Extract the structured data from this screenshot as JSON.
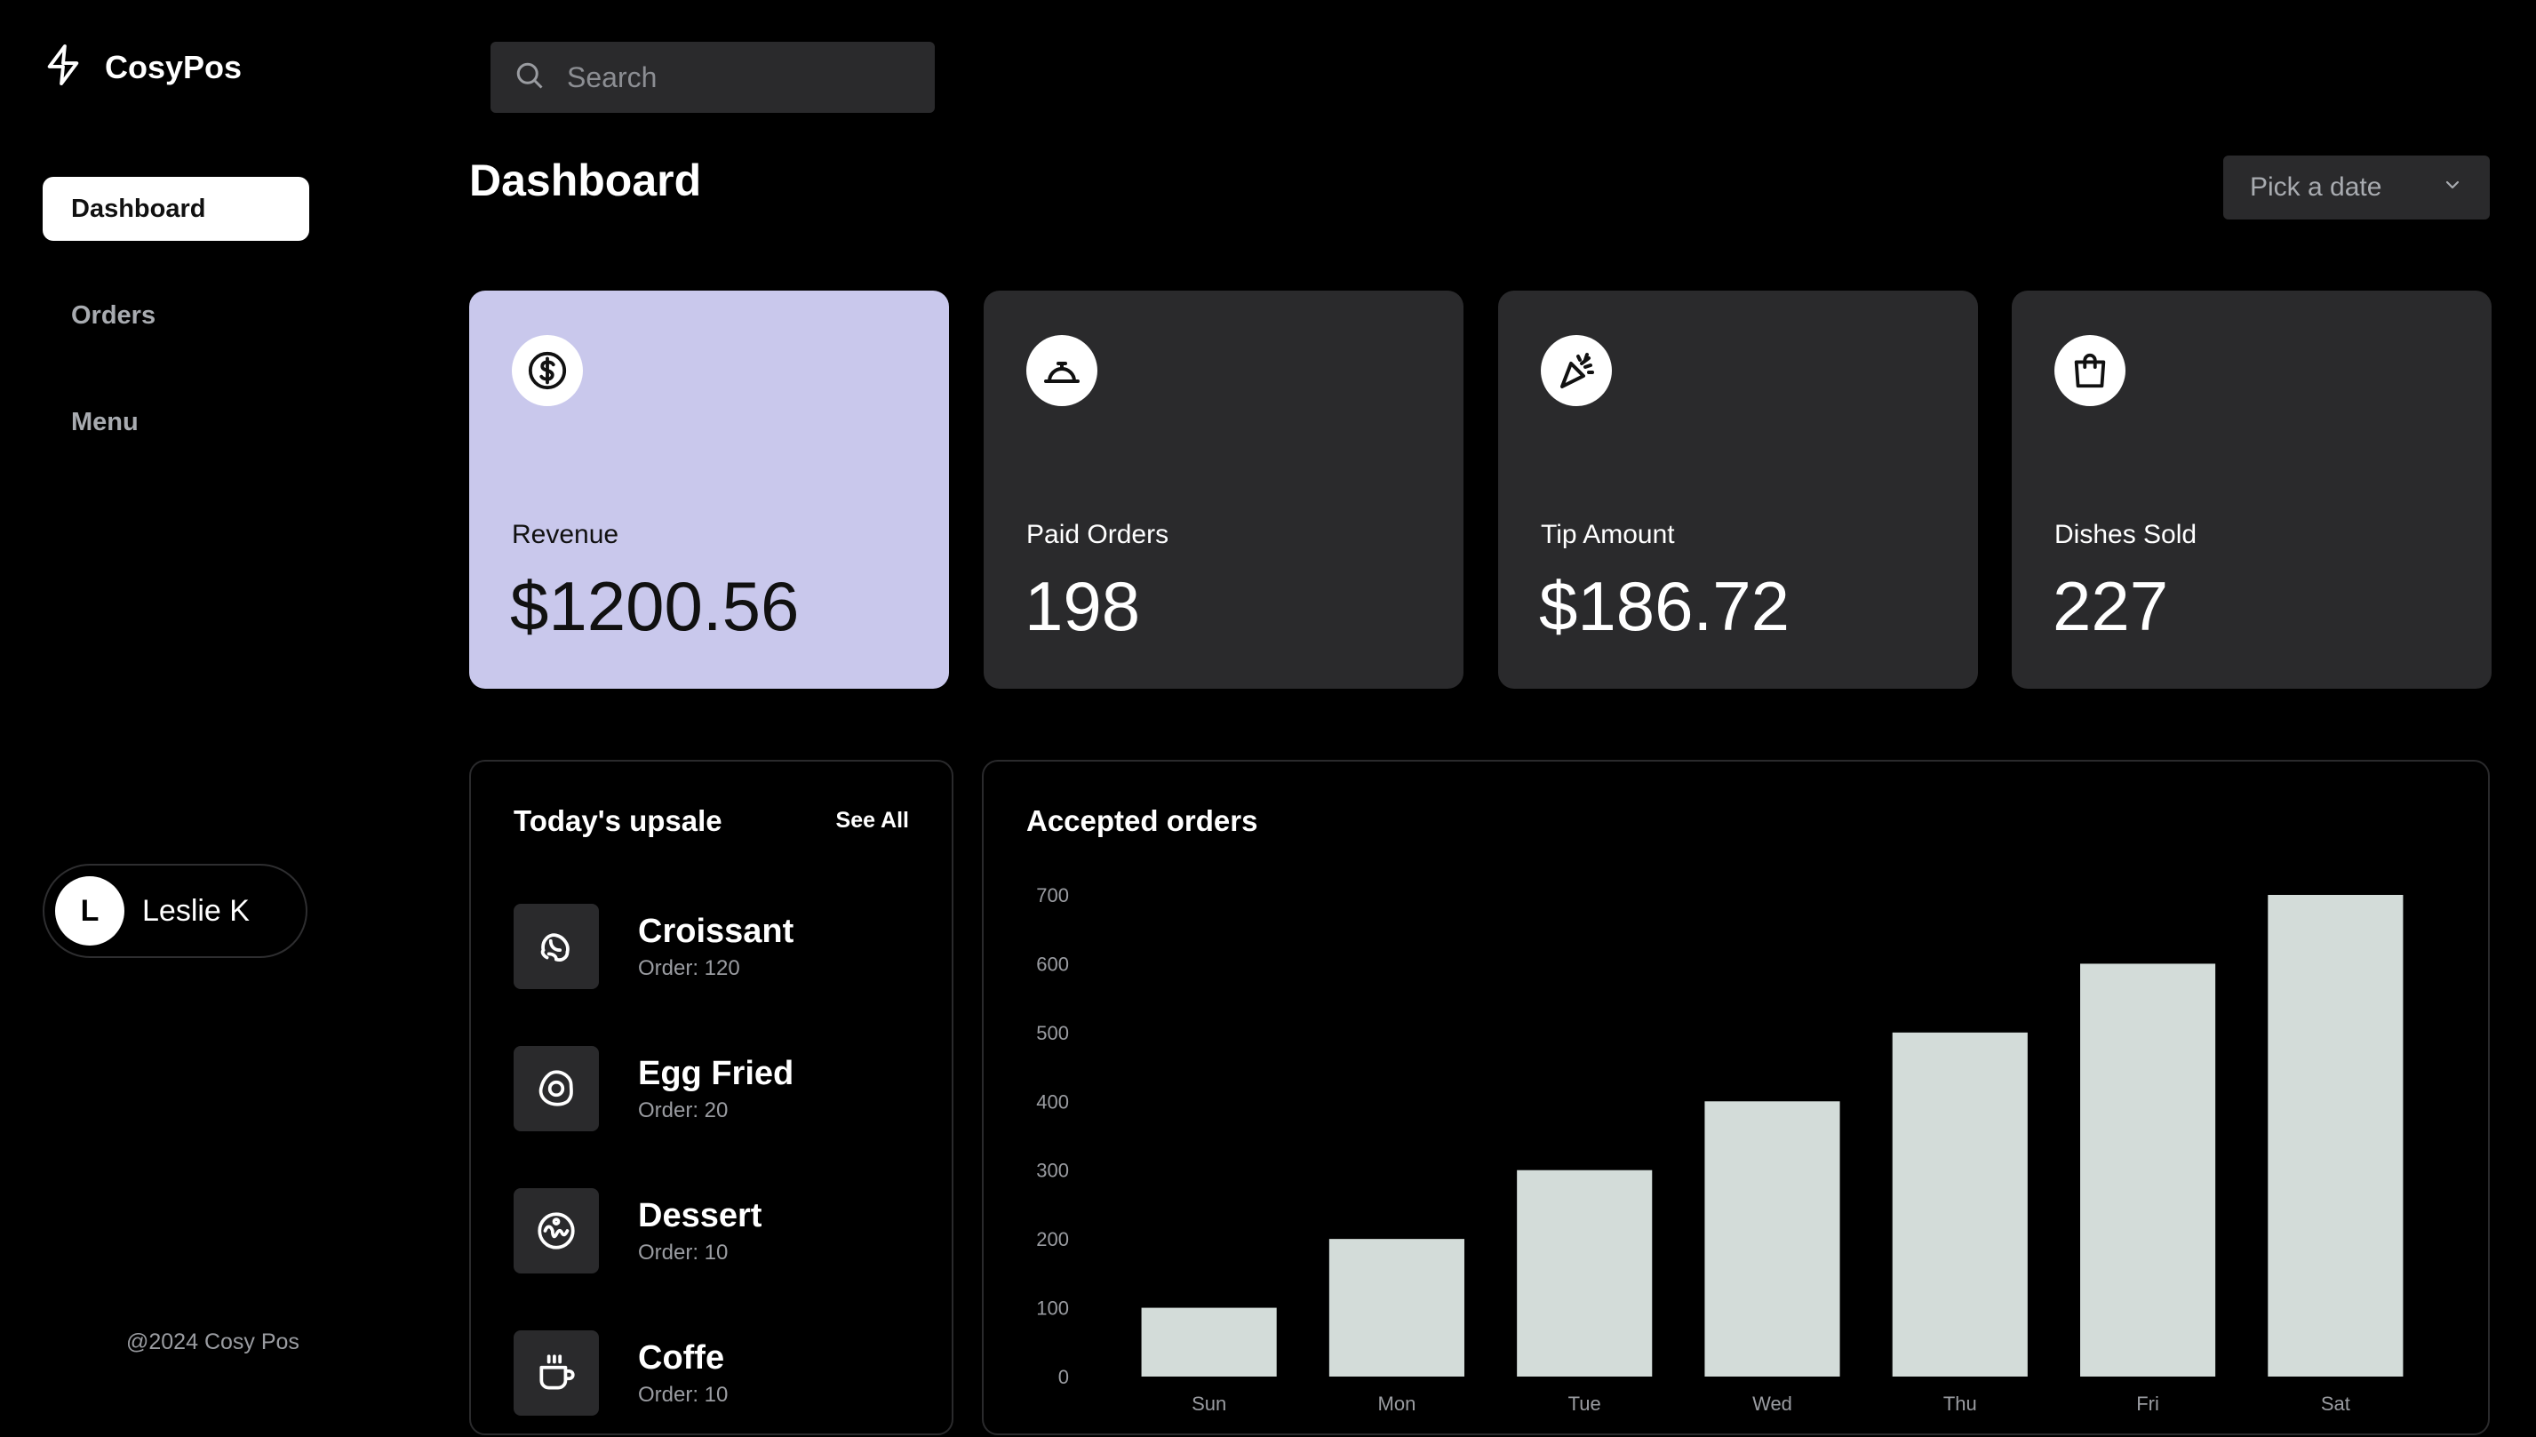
{
  "brand": {
    "name": "CosyPos",
    "icon": "bolt-icon"
  },
  "sidebar": {
    "items": [
      {
        "label": "Dashboard",
        "active": true
      },
      {
        "label": "Orders",
        "active": false
      },
      {
        "label": "Menu",
        "active": false
      }
    ],
    "user": {
      "initial": "L",
      "name": "Leslie K"
    },
    "footer": "@2024 Cosy Pos"
  },
  "search": {
    "placeholder": "Search"
  },
  "page": {
    "title": "Dashboard",
    "date_picker": "Pick a date"
  },
  "stats": [
    {
      "label": "Revenue",
      "value": "$1200.56",
      "icon": "dollar-circle-icon"
    },
    {
      "label": "Paid Orders",
      "value": "198",
      "icon": "service-bell-icon"
    },
    {
      "label": "Tip Amount",
      "value": "$186.72",
      "icon": "party-popper-icon"
    },
    {
      "label": "Dishes Sold",
      "value": "227",
      "icon": "shopping-bag-icon"
    }
  ],
  "upsale": {
    "title": "Today's upsale",
    "see_all": "See All",
    "items": [
      {
        "name": "Croissant",
        "order": "Order: 120",
        "icon": "croissant-icon"
      },
      {
        "name": "Egg Fried",
        "order": "Order: 20",
        "icon": "egg-fried-icon"
      },
      {
        "name": "Dessert",
        "order": "Order: 10",
        "icon": "dessert-icon"
      },
      {
        "name": "Coffe",
        "order": "Order: 10",
        "icon": "coffee-icon"
      }
    ]
  },
  "accepted_orders": {
    "title": "Accepted orders"
  },
  "colors": {
    "accent_card": "#c9c8ec",
    "bar": "#d3dcd9",
    "panel": "#2a2a2c"
  },
  "chart_data": {
    "type": "bar",
    "title": "Accepted orders",
    "categories": [
      "Sun",
      "Mon",
      "Tue",
      "Wed",
      "Thu",
      "Fri",
      "Sat"
    ],
    "values": [
      100,
      200,
      300,
      400,
      500,
      600,
      700
    ],
    "yticks": [
      0,
      100,
      200,
      300,
      400,
      500,
      600,
      700
    ],
    "ylim": [
      0,
      700
    ],
    "grid": false
  }
}
